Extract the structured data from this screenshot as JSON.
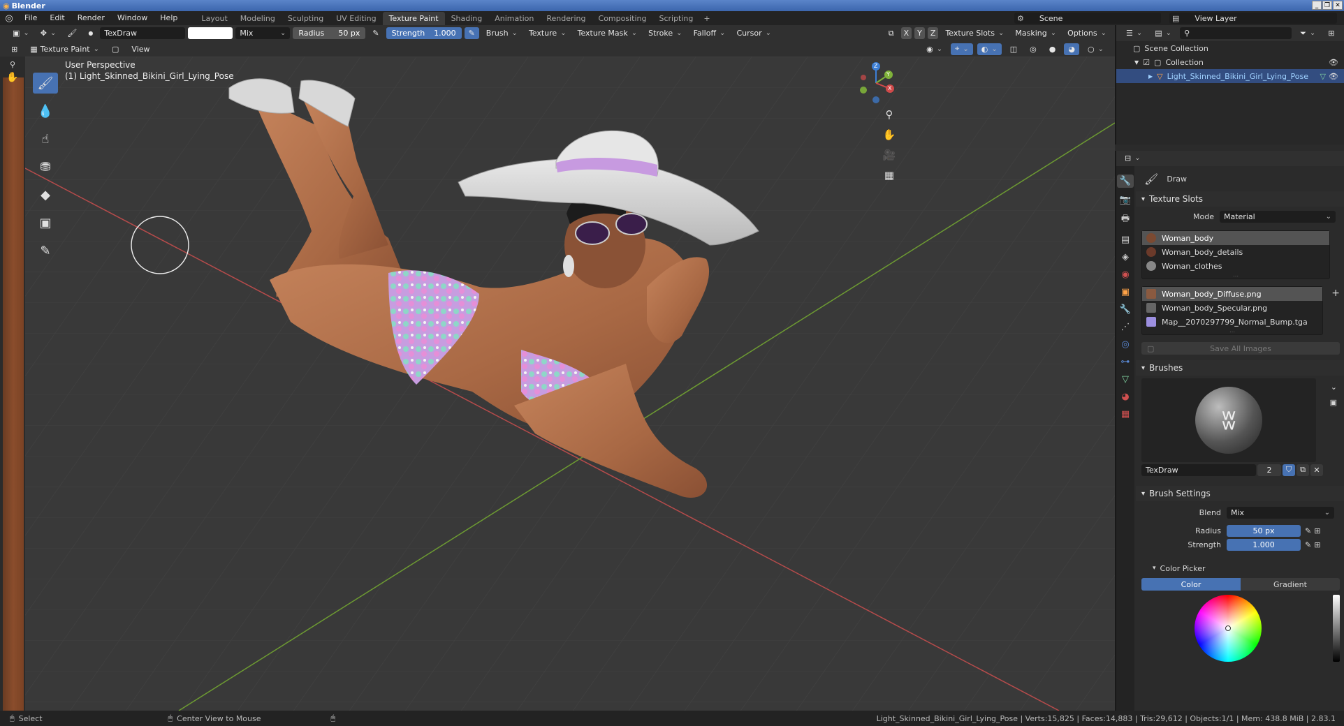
{
  "window": {
    "title": "Blender"
  },
  "menu": [
    "File",
    "Edit",
    "Render",
    "Window",
    "Help"
  ],
  "workspaces": [
    {
      "label": "Layout",
      "active": false
    },
    {
      "label": "Modeling",
      "active": false
    },
    {
      "label": "Sculpting",
      "active": false
    },
    {
      "label": "UV Editing",
      "active": false
    },
    {
      "label": "Texture Paint",
      "active": true
    },
    {
      "label": "Shading",
      "active": false
    },
    {
      "label": "Animation",
      "active": false
    },
    {
      "label": "Rendering",
      "active": false
    },
    {
      "label": "Compositing",
      "active": false
    },
    {
      "label": "Scripting",
      "active": false
    }
  ],
  "scene": "Scene",
  "view_layer": "View Layer",
  "tool_header": {
    "brush_name": "TexDraw",
    "blend": "Mix",
    "radius_label": "Radius",
    "radius_value": "50 px",
    "strength_label": "Strength",
    "strength_value": "1.000",
    "menus": [
      "Brush",
      "Texture",
      "Texture Mask",
      "Stroke",
      "Falloff",
      "Cursor"
    ],
    "axes": [
      "X",
      "Y",
      "Z"
    ],
    "right_menus": [
      "Texture Slots",
      "Masking",
      "Options"
    ]
  },
  "sub_header": {
    "mode": "Texture Paint",
    "view": "View"
  },
  "viewport": {
    "perspective": "User Perspective",
    "object_label": "(1) Light_Skinned_Bikini_Girl_Lying_Pose",
    "gizmo": {
      "x": "X",
      "y": "Y",
      "z": "Z"
    }
  },
  "outliner": {
    "scene_collection": "Scene Collection",
    "collection": "Collection",
    "object": "Light_Skinned_Bikini_Girl_Lying_Pose"
  },
  "properties": {
    "tool_name": "Draw",
    "texture_slots": {
      "header": "Texture Slots",
      "mode_label": "Mode",
      "mode_value": "Material",
      "materials": [
        {
          "name": "Woman_body",
          "color": "#7b4a32"
        },
        {
          "name": "Woman_body_details",
          "color": "#6b3a2a"
        },
        {
          "name": "Woman_clothes",
          "color": "#888888"
        }
      ],
      "images": [
        {
          "name": "Woman_body_Diffuse.png",
          "color": "#8a5a40"
        },
        {
          "name": "Woman_body_Specular.png",
          "color": "#666666"
        },
        {
          "name": "Map__2070297799_Normal_Bump.tga",
          "color": "#9c8fe0"
        }
      ],
      "save_all": "Save All Images"
    },
    "brushes": {
      "header": "Brushes",
      "name": "TexDraw",
      "users": "2"
    },
    "brush_settings": {
      "header": "Brush Settings",
      "blend_label": "Blend",
      "blend_value": "Mix",
      "radius_label": "Radius",
      "radius_value": "50 px",
      "strength_label": "Strength",
      "strength_value": "1.000",
      "color_picker": "Color Picker",
      "tab_color": "Color",
      "tab_gradient": "Gradient"
    }
  },
  "statusbar": {
    "select": "Select",
    "center_view": "Center View to Mouse",
    "stats": "Light_Skinned_Bikini_Girl_Lying_Pose | Verts:15,825 | Faces:14,883 | Tris:29,612 | Objects:1/1 | Mem: 438.8 MiB | 2.83.1"
  },
  "colors": {
    "accent": "#4772b3",
    "selection": "#334d80",
    "background": "#393939",
    "x_axis": "#d04a4a",
    "y_axis": "#7fb23a",
    "z_axis": "#3d7fd6"
  }
}
